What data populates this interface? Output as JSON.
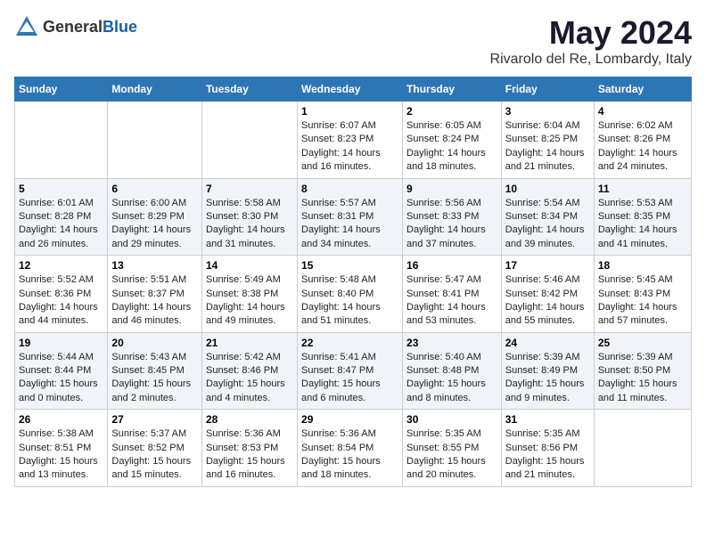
{
  "logo": {
    "general": "General",
    "blue": "Blue"
  },
  "header": {
    "title": "May 2024",
    "subtitle": "Rivarolo del Re, Lombardy, Italy"
  },
  "weekdays": [
    "Sunday",
    "Monday",
    "Tuesday",
    "Wednesday",
    "Thursday",
    "Friday",
    "Saturday"
  ],
  "weeks": [
    [
      {
        "day": "",
        "sunrise": "",
        "sunset": "",
        "daylight": ""
      },
      {
        "day": "",
        "sunrise": "",
        "sunset": "",
        "daylight": ""
      },
      {
        "day": "",
        "sunrise": "",
        "sunset": "",
        "daylight": ""
      },
      {
        "day": "1",
        "sunrise": "Sunrise: 6:07 AM",
        "sunset": "Sunset: 8:23 PM",
        "daylight": "Daylight: 14 hours and 16 minutes."
      },
      {
        "day": "2",
        "sunrise": "Sunrise: 6:05 AM",
        "sunset": "Sunset: 8:24 PM",
        "daylight": "Daylight: 14 hours and 18 minutes."
      },
      {
        "day": "3",
        "sunrise": "Sunrise: 6:04 AM",
        "sunset": "Sunset: 8:25 PM",
        "daylight": "Daylight: 14 hours and 21 minutes."
      },
      {
        "day": "4",
        "sunrise": "Sunrise: 6:02 AM",
        "sunset": "Sunset: 8:26 PM",
        "daylight": "Daylight: 14 hours and 24 minutes."
      }
    ],
    [
      {
        "day": "5",
        "sunrise": "Sunrise: 6:01 AM",
        "sunset": "Sunset: 8:28 PM",
        "daylight": "Daylight: 14 hours and 26 minutes."
      },
      {
        "day": "6",
        "sunrise": "Sunrise: 6:00 AM",
        "sunset": "Sunset: 8:29 PM",
        "daylight": "Daylight: 14 hours and 29 minutes."
      },
      {
        "day": "7",
        "sunrise": "Sunrise: 5:58 AM",
        "sunset": "Sunset: 8:30 PM",
        "daylight": "Daylight: 14 hours and 31 minutes."
      },
      {
        "day": "8",
        "sunrise": "Sunrise: 5:57 AM",
        "sunset": "Sunset: 8:31 PM",
        "daylight": "Daylight: 14 hours and 34 minutes."
      },
      {
        "day": "9",
        "sunrise": "Sunrise: 5:56 AM",
        "sunset": "Sunset: 8:33 PM",
        "daylight": "Daylight: 14 hours and 37 minutes."
      },
      {
        "day": "10",
        "sunrise": "Sunrise: 5:54 AM",
        "sunset": "Sunset: 8:34 PM",
        "daylight": "Daylight: 14 hours and 39 minutes."
      },
      {
        "day": "11",
        "sunrise": "Sunrise: 5:53 AM",
        "sunset": "Sunset: 8:35 PM",
        "daylight": "Daylight: 14 hours and 41 minutes."
      }
    ],
    [
      {
        "day": "12",
        "sunrise": "Sunrise: 5:52 AM",
        "sunset": "Sunset: 8:36 PM",
        "daylight": "Daylight: 14 hours and 44 minutes."
      },
      {
        "day": "13",
        "sunrise": "Sunrise: 5:51 AM",
        "sunset": "Sunset: 8:37 PM",
        "daylight": "Daylight: 14 hours and 46 minutes."
      },
      {
        "day": "14",
        "sunrise": "Sunrise: 5:49 AM",
        "sunset": "Sunset: 8:38 PM",
        "daylight": "Daylight: 14 hours and 49 minutes."
      },
      {
        "day": "15",
        "sunrise": "Sunrise: 5:48 AM",
        "sunset": "Sunset: 8:40 PM",
        "daylight": "Daylight: 14 hours and 51 minutes."
      },
      {
        "day": "16",
        "sunrise": "Sunrise: 5:47 AM",
        "sunset": "Sunset: 8:41 PM",
        "daylight": "Daylight: 14 hours and 53 minutes."
      },
      {
        "day": "17",
        "sunrise": "Sunrise: 5:46 AM",
        "sunset": "Sunset: 8:42 PM",
        "daylight": "Daylight: 14 hours and 55 minutes."
      },
      {
        "day": "18",
        "sunrise": "Sunrise: 5:45 AM",
        "sunset": "Sunset: 8:43 PM",
        "daylight": "Daylight: 14 hours and 57 minutes."
      }
    ],
    [
      {
        "day": "19",
        "sunrise": "Sunrise: 5:44 AM",
        "sunset": "Sunset: 8:44 PM",
        "daylight": "Daylight: 15 hours and 0 minutes."
      },
      {
        "day": "20",
        "sunrise": "Sunrise: 5:43 AM",
        "sunset": "Sunset: 8:45 PM",
        "daylight": "Daylight: 15 hours and 2 minutes."
      },
      {
        "day": "21",
        "sunrise": "Sunrise: 5:42 AM",
        "sunset": "Sunset: 8:46 PM",
        "daylight": "Daylight: 15 hours and 4 minutes."
      },
      {
        "day": "22",
        "sunrise": "Sunrise: 5:41 AM",
        "sunset": "Sunset: 8:47 PM",
        "daylight": "Daylight: 15 hours and 6 minutes."
      },
      {
        "day": "23",
        "sunrise": "Sunrise: 5:40 AM",
        "sunset": "Sunset: 8:48 PM",
        "daylight": "Daylight: 15 hours and 8 minutes."
      },
      {
        "day": "24",
        "sunrise": "Sunrise: 5:39 AM",
        "sunset": "Sunset: 8:49 PM",
        "daylight": "Daylight: 15 hours and 9 minutes."
      },
      {
        "day": "25",
        "sunrise": "Sunrise: 5:39 AM",
        "sunset": "Sunset: 8:50 PM",
        "daylight": "Daylight: 15 hours and 11 minutes."
      }
    ],
    [
      {
        "day": "26",
        "sunrise": "Sunrise: 5:38 AM",
        "sunset": "Sunset: 8:51 PM",
        "daylight": "Daylight: 15 hours and 13 minutes."
      },
      {
        "day": "27",
        "sunrise": "Sunrise: 5:37 AM",
        "sunset": "Sunset: 8:52 PM",
        "daylight": "Daylight: 15 hours and 15 minutes."
      },
      {
        "day": "28",
        "sunrise": "Sunrise: 5:36 AM",
        "sunset": "Sunset: 8:53 PM",
        "daylight": "Daylight: 15 hours and 16 minutes."
      },
      {
        "day": "29",
        "sunrise": "Sunrise: 5:36 AM",
        "sunset": "Sunset: 8:54 PM",
        "daylight": "Daylight: 15 hours and 18 minutes."
      },
      {
        "day": "30",
        "sunrise": "Sunrise: 5:35 AM",
        "sunset": "Sunset: 8:55 PM",
        "daylight": "Daylight: 15 hours and 20 minutes."
      },
      {
        "day": "31",
        "sunrise": "Sunrise: 5:35 AM",
        "sunset": "Sunset: 8:56 PM",
        "daylight": "Daylight: 15 hours and 21 minutes."
      },
      {
        "day": "",
        "sunrise": "",
        "sunset": "",
        "daylight": ""
      }
    ]
  ]
}
